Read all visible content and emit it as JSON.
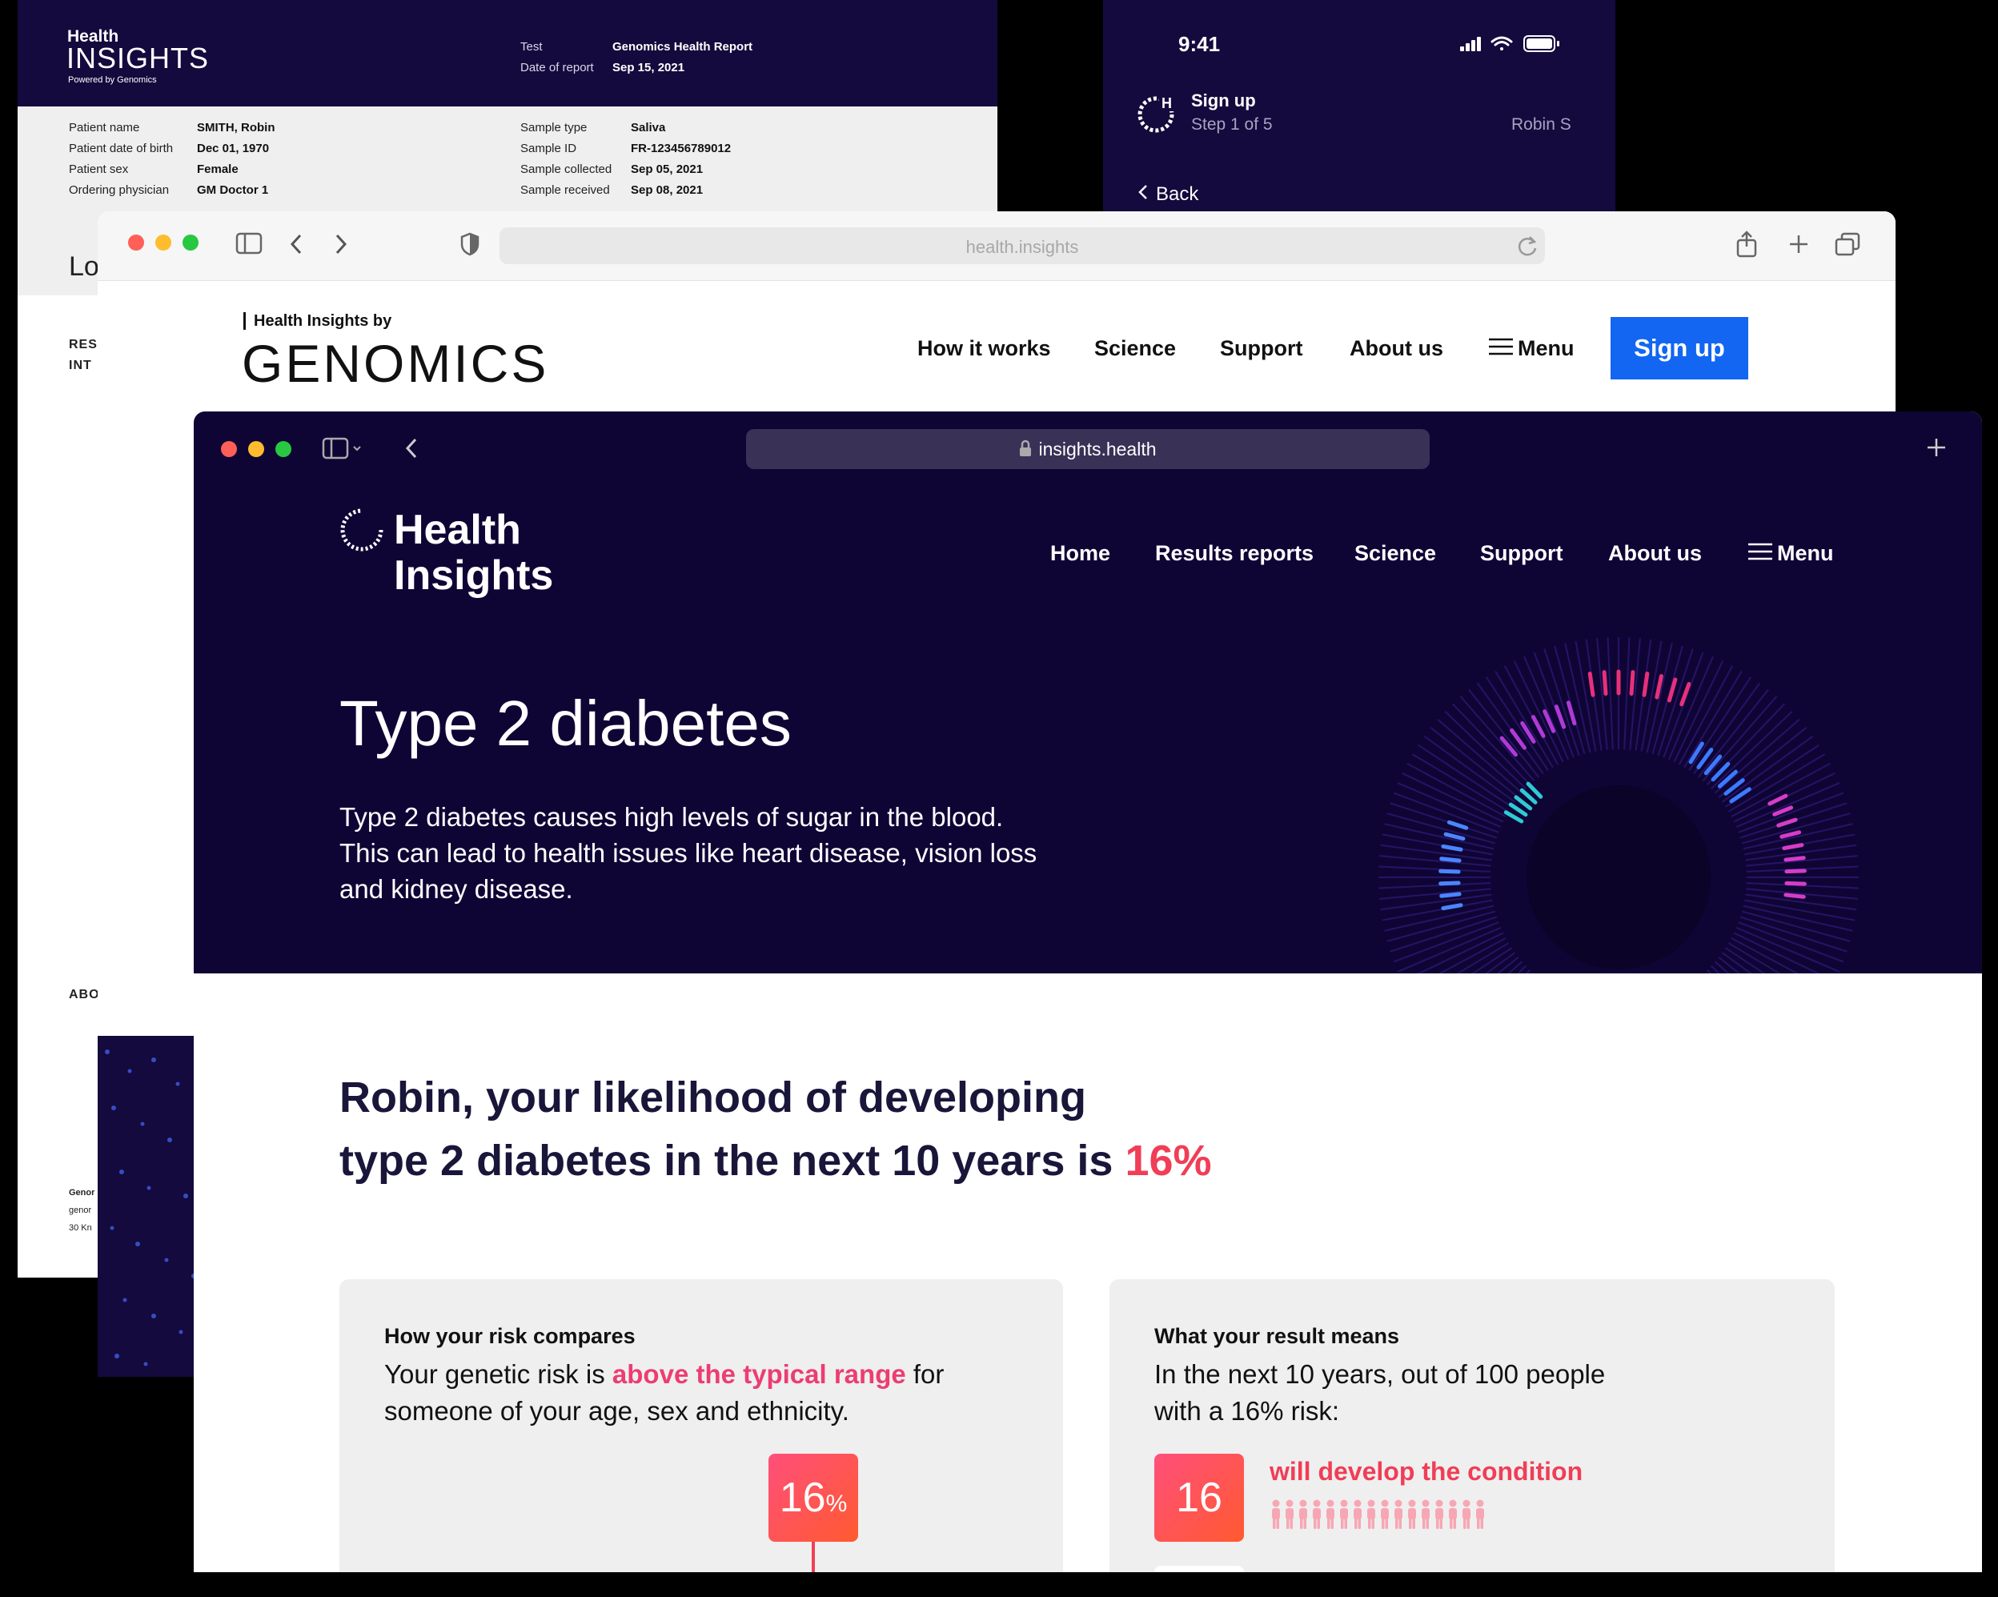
{
  "report": {
    "logo_top": "Health",
    "logo_main": "INSIGHTS",
    "logo_sub": "Powered by Genomics",
    "test_label": "Test",
    "test_value": "Genomics Health Report",
    "date_label": "Date of report",
    "date_value": "Sep 15, 2021",
    "fields_left": [
      {
        "label": "Patient name",
        "value": "SMITH, Robin"
      },
      {
        "label": "Patient date of birth",
        "value": "Dec 01, 1970"
      },
      {
        "label": "Patient sex",
        "value": "Female"
      },
      {
        "label": "Ordering physician",
        "value": "GM Doctor 1"
      }
    ],
    "fields_right": [
      {
        "label": "Sample type",
        "value": "Saliva"
      },
      {
        "label": "Sample ID",
        "value": "FR-123456789012"
      },
      {
        "label": "Sample collected",
        "value": "Sep 05, 2021"
      },
      {
        "label": "Sample received",
        "value": "Sep 08, 2021"
      }
    ],
    "partial_heading": "Lo",
    "side_1": "RES",
    "side_2": "INT",
    "side_3": "ABO",
    "foot_1": "Genor",
    "foot_2": "genor",
    "foot_3": "30 Kn"
  },
  "phone": {
    "time": "9:41",
    "title": "Sign up",
    "step": "Step 1 of 5",
    "user": "Robin S",
    "back": "Back"
  },
  "genomics": {
    "url": "health.insights",
    "brand_by": "Health Insights by",
    "brand_main": "GENOMICS",
    "nav": [
      "How it works",
      "Science",
      "Support",
      "About us"
    ],
    "menu": "Menu",
    "signup": "Sign up"
  },
  "main": {
    "url": "insights.health",
    "logo_line1": "Health",
    "logo_line2": "Insights",
    "nav": [
      "Home",
      "Results reports",
      "Science",
      "Support",
      "About us"
    ],
    "menu": "Menu",
    "title": "Type 2 diabetes",
    "description": "Type 2 diabetes causes high levels of sugar in the blood. This can lead to health issues like heart disease, vision loss and kidney disease.",
    "headline_1": "Robin, your likelihood of developing",
    "headline_2": "type 2 diabetes in the next 10 years is",
    "headline_pct": "16%",
    "card1": {
      "title": "How your risk compares",
      "body_pre": "Your genetic risk is",
      "body_highlight": "above the typical range",
      "body_post": "for someone of your age, sex and ethnicity.",
      "badge_value": "16",
      "badge_unit": "%"
    },
    "card2": {
      "title": "What your result means",
      "body": "In the next 10 years, out of 100 people with a 16% risk:",
      "badge_value": "16",
      "develop_label": "will develop the condition",
      "people_count": 16
    }
  },
  "colors": {
    "navy": "#150a3d",
    "hero": "#0f0535",
    "accent": "#f03e56",
    "pink": "#ec3d72",
    "button_blue": "#1266f1"
  }
}
